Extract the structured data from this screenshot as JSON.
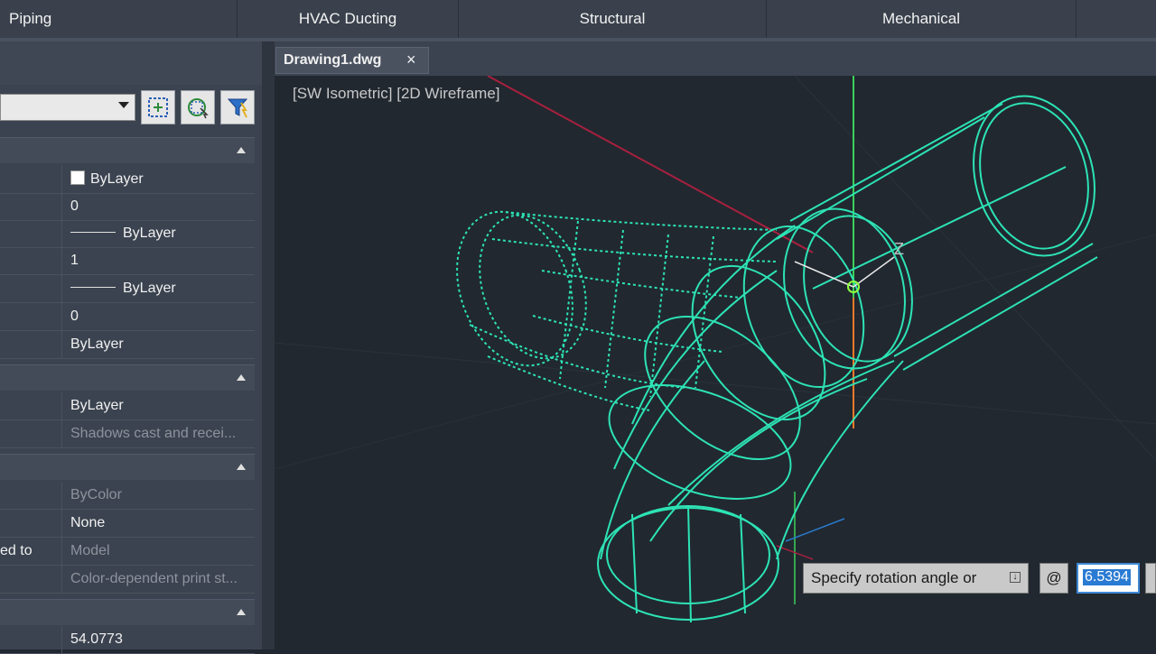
{
  "ribbon": {
    "tabs": [
      "Piping",
      "HVAC Ducting",
      "Structural",
      "Mechanical"
    ]
  },
  "document": {
    "tab_name": "Drawing1.dwg",
    "close_glyph": "×",
    "view_label": "[SW Isometric] [2D Wireframe]"
  },
  "palette": {
    "general_rows": [
      {
        "value": "ByLayer",
        "glyph": "swatch"
      },
      {
        "value": "0"
      },
      {
        "value": "ByLayer",
        "glyph": "line"
      },
      {
        "value": "1"
      },
      {
        "value": "ByLayer",
        "glyph": "line"
      },
      {
        "value": "0"
      },
      {
        "value": "ByLayer"
      }
    ],
    "render_rows": [
      {
        "value": "ByLayer"
      },
      {
        "value": "Shadows cast and recei...",
        "dim": true
      }
    ],
    "plot_rows": [
      {
        "label": "",
        "value": "ByColor",
        "dim": true
      },
      {
        "label": "",
        "value": "None"
      },
      {
        "label": "ed to",
        "value": "Model",
        "dim": true
      },
      {
        "label": "",
        "value": "Color-dependent print st...",
        "dim": true
      }
    ],
    "bottom_row": {
      "value": "54.0773"
    }
  },
  "command": {
    "prompt": "Specify rotation angle or",
    "at_symbol": "@",
    "angle_value": "6.5394"
  },
  "viewport": {
    "axis_label_z": "Z"
  },
  "colors": {
    "wireframe": "#2de3b5",
    "y_axis": "#3cd05a",
    "z_axis": "#f07a2a",
    "x_axis": "#a8203e"
  }
}
